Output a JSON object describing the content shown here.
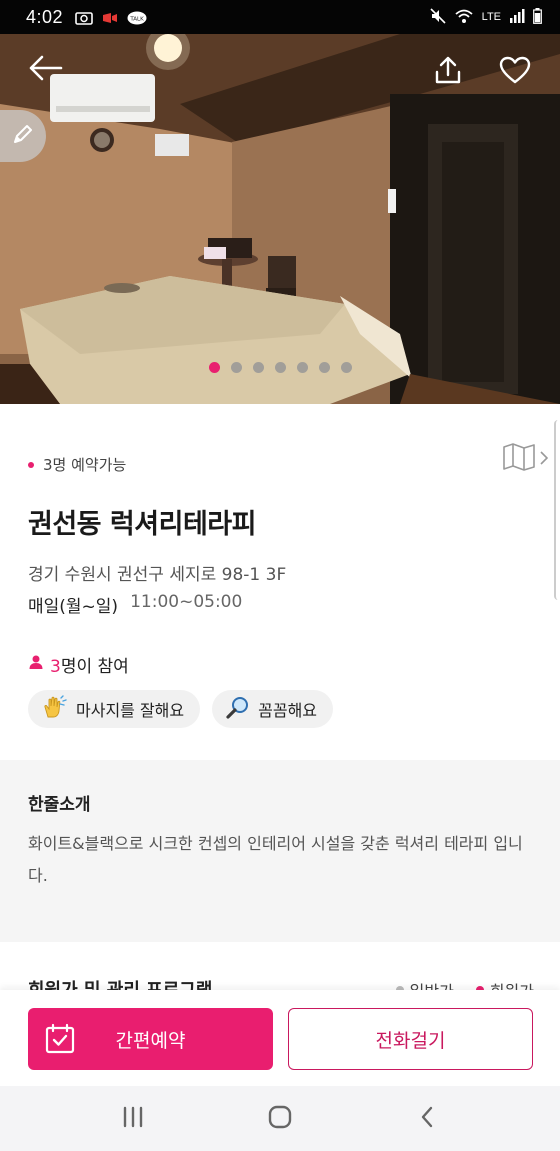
{
  "status_bar": {
    "time": "4:02",
    "left_icons": [
      "image-icon",
      "youtube-icon",
      "kakaotalk-icon"
    ],
    "right_icons": [
      "mute-icon",
      "wifi-icon",
      "lte-icon",
      "signal-icon",
      "battery-icon"
    ],
    "network_label": "LTE"
  },
  "hero": {
    "carousel_count": 7,
    "carousel_active_index": 0,
    "icons": {
      "back": "back-arrow-icon",
      "share": "share-icon",
      "favorite": "heart-icon",
      "edit": "pencil-icon"
    }
  },
  "shop": {
    "availability": "3명 예약가능",
    "name": "권선동 럭셔리테라피",
    "address": "경기 수원시 권선구 세지로 98-1 3F",
    "hours_days": "매일(월~일)",
    "hours_time": "11:00~05:00",
    "participants_count": "3",
    "participants_suffix": "명이 참여",
    "tags": [
      {
        "icon": "clapping-hands-icon",
        "label": "마사지를 잘해요"
      },
      {
        "icon": "magnifier-icon",
        "label": "꼼꼼해요"
      }
    ]
  },
  "intro": {
    "title": "한줄소개",
    "text": "화이트&블랙으로 시크한 컨셉의 인테리어 시설을 갖춘 럭셔리 테라피 입니다."
  },
  "next_section": {
    "title": "회원가 및 관리 프로그램",
    "legend_general": "일반가",
    "legend_member": "회원가"
  },
  "actions": {
    "reserve_label": "간편예약",
    "call_label": "전화걸기"
  },
  "colors": {
    "accent": "#e91e6f",
    "accent_dark": "#c9185e",
    "section_bg": "#f5f5f5"
  }
}
